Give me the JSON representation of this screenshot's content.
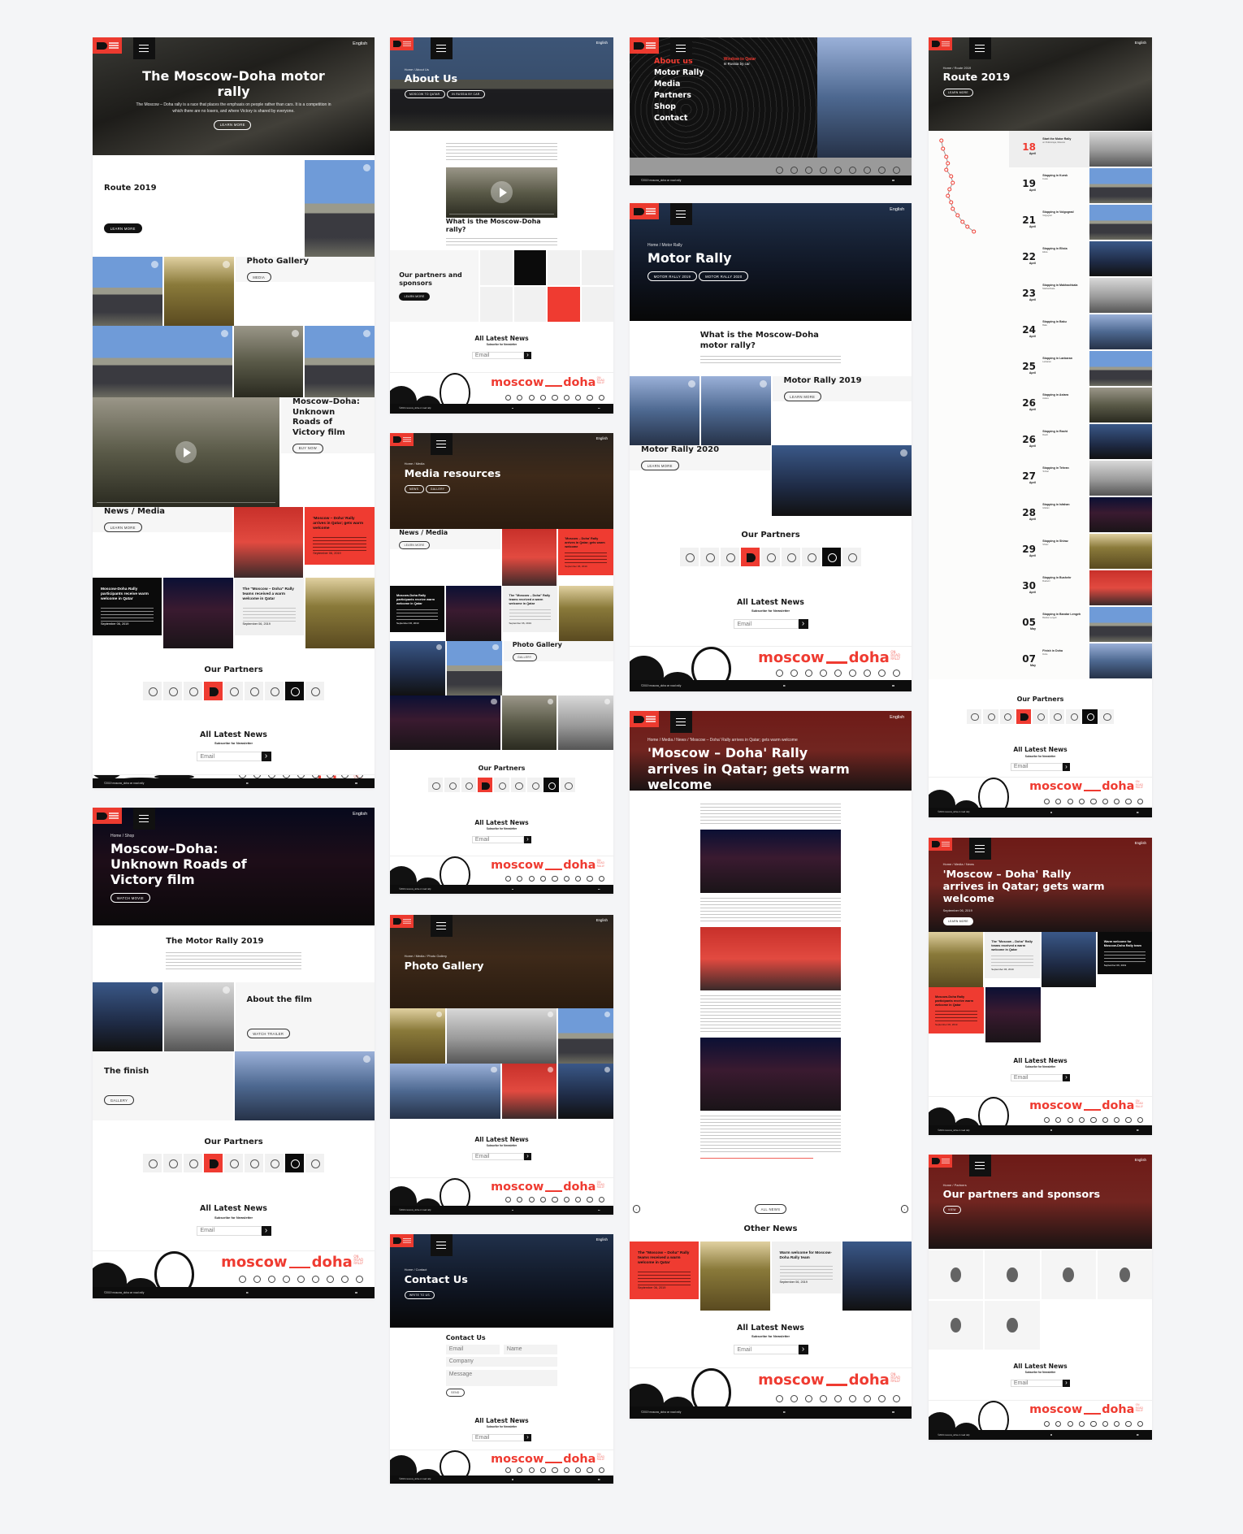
{
  "colors": {
    "accent": "#ef3b31",
    "dark": "#0d0d0d",
    "panel": "#f6f6f6",
    "page_bg": "#f4f5f7"
  },
  "common": {
    "language": "English",
    "partners_title": "Our Partners",
    "newsletter": {
      "title": "All Latest News",
      "subtitle": "Subscribe for Newsletter",
      "placeholder": "Email",
      "submit_icon": "arrow-right-icon"
    },
    "footer": {
      "brand_left": "moscow",
      "brand_right": "doha",
      "tagline": [
        "ON",
        "ROAD",
        "RALLY"
      ],
      "copyright": "©2019 moscow_doha on road rally"
    },
    "partner_logos": [
      "qatar-logo",
      "ministry-emblem",
      "state-emblem",
      "moscow-doha-mark",
      "victory-museum-logo",
      "road-sign-logo",
      "uaz-logo",
      "moscow-doha-black-logo",
      "russian-rally-logo"
    ]
  },
  "news_cards": [
    {
      "title": "'Moscow – Doha' Rally arrives in Qatar; gets warm welcome",
      "date": "September 06, 2019"
    },
    {
      "title": "Moscow-Doha Rally participants receive warm welcome in Qatar",
      "date": "September 06, 2019"
    },
    {
      "title": "The \"Moscow – Doha\" Rally teams received a warm welcome in Qatar",
      "date": "September 06, 2019"
    },
    {
      "title": "Warm welcome for Moscow-Doha Rally team",
      "date": "September 06, 2019"
    }
  ],
  "home": {
    "hero": {
      "title": "The Moscow–Doha motor rally",
      "text": "The Moscow – Doha rally is a race that places the emphasis on people rather than cars. It is a competition in which there are no losers, and where Victory is shared by everyone.",
      "button": "Learn more"
    },
    "route": {
      "title": "Route 2019",
      "button": "Learn more"
    },
    "gallery": {
      "title": "Photo Gallery",
      "button": "Media"
    },
    "film": {
      "title": "Moscow–Doha: Unknown Roads of Victory film",
      "button": "Buy now"
    },
    "news": {
      "title": "News / Media",
      "button": "Learn more"
    }
  },
  "film_page": {
    "hero": {
      "breadcrumb": "Home / Shop",
      "title": "Moscow–Doha: Unknown Roads of Victory film",
      "button": "Watch movie"
    },
    "rally": {
      "title": "The Motor Rally 2019"
    },
    "about": {
      "title": "About the film",
      "button": "Watch trailer"
    },
    "finish": {
      "title": "The finish",
      "button": "Gallery"
    }
  },
  "about_page": {
    "hero": {
      "breadcrumb": "Home / About Us",
      "title": "About Us",
      "buttons": [
        "Moscow to Qatar",
        "In Russia by car"
      ]
    },
    "question": "What is the Moscow-Doha rally?",
    "partners": {
      "title": "Our partners and sponsors",
      "button": "Learn more"
    }
  },
  "media_page": {
    "hero": {
      "breadcrumb": "Home / Media",
      "title": "Media resources",
      "buttons": [
        "News",
        "Gallery"
      ]
    },
    "news": {
      "title": "News / Media",
      "button": "Learn more"
    },
    "gallery": {
      "title": "Photo Gallery",
      "button": "Gallery"
    }
  },
  "gallery_page": {
    "hero": {
      "breadcrumb": "Home / Media / Photo Gallery",
      "title": "Photo Gallery"
    }
  },
  "contact_page": {
    "hero": {
      "breadcrumb": "Home / Contact",
      "title": "Contact Us",
      "button": "Write to us"
    },
    "form": {
      "title": "Contact Us",
      "email": "Email",
      "name": "Name",
      "company": "Company",
      "message": "Message",
      "send": "Send"
    }
  },
  "menu_page": {
    "items": [
      "About us",
      "Motor Rally",
      "Media",
      "Partners",
      "Shop",
      "Contact"
    ],
    "active": "About us",
    "promo_title": "Window to Qatar",
    "promo_sub": "In Russia by car"
  },
  "rally_page": {
    "hero": {
      "breadcrumb": "Home / Motor Rally",
      "title": "Motor Rally",
      "buttons": [
        "Motor Rally 2019",
        "Motor Rally 2020"
      ]
    },
    "question": "What is the Moscow-Doha motor rally?",
    "r2019": {
      "title": "Motor Rally 2019",
      "button": "Learn more"
    },
    "r2020": {
      "title": "Motor Rally 2020",
      "button": "Learn more"
    }
  },
  "article_page": {
    "hero": {
      "breadcrumb": "Home / Media / News / 'Moscow – Doha' Rally arrives in Qatar; gets warm welcome",
      "title": "'Moscow – Doha' Rally arrives in Qatar; gets warm welcome"
    },
    "all_news": "All news",
    "other_news": "Other News"
  },
  "route_page": {
    "hero": {
      "breadcrumb": "Home / Route 2019",
      "title": "Route 2019",
      "button": "Learn more"
    },
    "stops": [
      {
        "day": "18",
        "month": "April",
        "title": "Start the Motor Rally",
        "place": "on Poklonnaya, Moscow"
      },
      {
        "day": "19",
        "month": "April",
        "title": "Stopping in Kursk",
        "place": "Kursk"
      },
      {
        "day": "21",
        "month": "April",
        "title": "Stopping in Volgograd",
        "place": "Volgograd"
      },
      {
        "day": "22",
        "month": "April",
        "title": "Stopping in Elista",
        "place": "Elista"
      },
      {
        "day": "23",
        "month": "April",
        "title": "Stopping in Makhachkala",
        "place": "Makhachkala"
      },
      {
        "day": "24",
        "month": "April",
        "title": "Stopping in Baku",
        "place": "Baku"
      },
      {
        "day": "25",
        "month": "April",
        "title": "Stopping in Lankaran",
        "place": "Lankaran"
      },
      {
        "day": "26",
        "month": "April",
        "title": "Stopping in Astara",
        "place": "Astara"
      },
      {
        "day": "26",
        "month": "April",
        "title": "Stopping in Rasht",
        "place": "Rasht"
      },
      {
        "day": "27",
        "month": "April",
        "title": "Stopping in Tehran",
        "place": "Tehran"
      },
      {
        "day": "28",
        "month": "April",
        "title": "Stopping in Isfahan",
        "place": "Isfahan"
      },
      {
        "day": "29",
        "month": "April",
        "title": "Stopping in Shiraz",
        "place": "Shiraz"
      },
      {
        "day": "30",
        "month": "April",
        "title": "Stopping in Bushehr",
        "place": "Bushehr"
      },
      {
        "day": "05",
        "month": "May",
        "title": "Stopping in Bandar Lengeh",
        "place": "Bandar Lengeh"
      },
      {
        "day": "07",
        "month": "May",
        "title": "Finish in Doha",
        "place": "Doha"
      }
    ]
  },
  "news_page": {
    "hero": {
      "breadcrumb": "Home / Media / News",
      "title": "'Moscow – Doha' Rally arrives in Qatar; gets warm welcome",
      "date": "September 06, 2019",
      "button": "Learn more"
    }
  },
  "partners_page": {
    "hero": {
      "breadcrumb": "Home / Partners",
      "title": "Our partners and sponsors",
      "button": "View"
    },
    "logos": [
      "cloud-logo",
      "ring-logo",
      "qatar-logo",
      "russian-rally-logo",
      "emblem-logo",
      "museum-logo"
    ]
  }
}
